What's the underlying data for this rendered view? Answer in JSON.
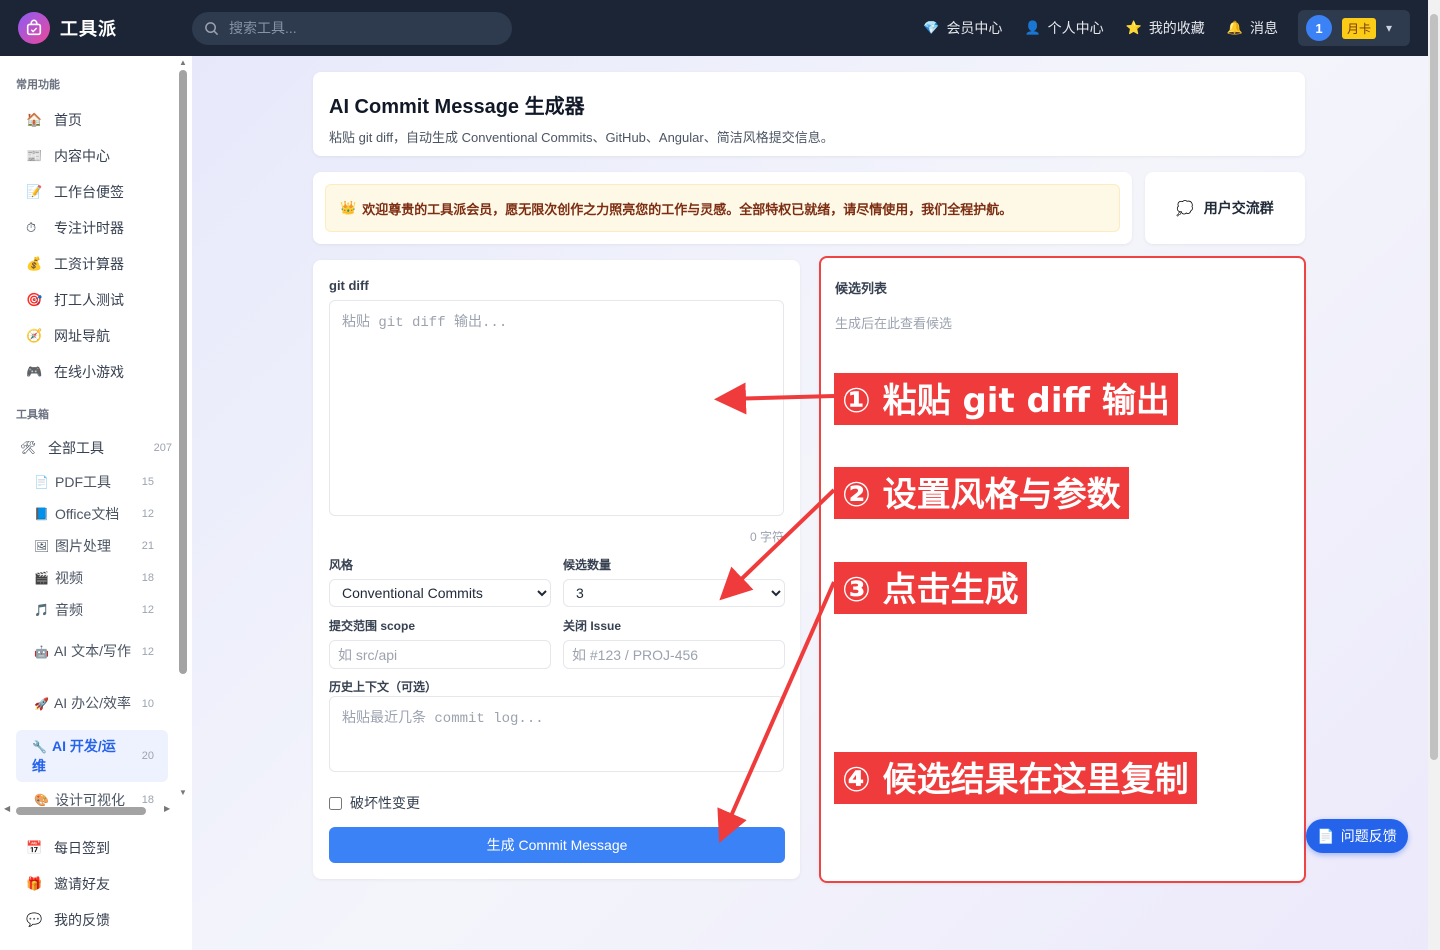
{
  "app": {
    "name": "工具派",
    "search_placeholder": "搜索工具..."
  },
  "topnav": {
    "links": [
      {
        "icon": "diamond-icon",
        "glyph": "💎",
        "label": "会员中心"
      },
      {
        "icon": "person-icon",
        "glyph": "👤",
        "label": "个人中心"
      },
      {
        "icon": "star-icon",
        "glyph": "⭐",
        "label": "我的收藏"
      },
      {
        "icon": "bell-icon",
        "glyph": "🔔",
        "label": "消息"
      }
    ],
    "user": {
      "avatar": "1",
      "plan": "月卡"
    }
  },
  "sidebar": {
    "section_common": "常用功能",
    "common": [
      {
        "glyph": "🏠",
        "label": "首页"
      },
      {
        "glyph": "📰",
        "label": "内容中心"
      },
      {
        "glyph": "📝",
        "label": "工作台便签"
      },
      {
        "glyph": "⏱",
        "label": "专注计时器"
      },
      {
        "glyph": "💰",
        "label": "工资计算器"
      },
      {
        "glyph": "🎯",
        "label": "打工人测试"
      },
      {
        "glyph": "🧭",
        "label": "网址导航"
      },
      {
        "glyph": "🎮",
        "label": "在线小游戏"
      }
    ],
    "section_tools": "工具箱",
    "all_tools": {
      "glyph": "🛠",
      "label": "全部工具",
      "count": "207"
    },
    "categories": [
      {
        "glyph": "📄",
        "label": "PDF工具",
        "count": "15"
      },
      {
        "glyph": "📘",
        "label": "Office文档",
        "count": "12"
      },
      {
        "glyph": "🖼",
        "label": "图片处理",
        "count": "21"
      },
      {
        "glyph": "🎬",
        "label": "视频",
        "count": "18"
      },
      {
        "glyph": "🎵",
        "label": "音频",
        "count": "12"
      },
      {
        "glyph": "🤖",
        "label": "AI 文本/写作",
        "count": "12"
      },
      {
        "glyph": "🚀",
        "label": "AI 办公/效率",
        "count": "10"
      },
      {
        "glyph": "🔧",
        "label": "AI 开发/运维",
        "count": "20",
        "active": true
      },
      {
        "glyph": "🎨",
        "label": "设计可视化",
        "count": "18"
      }
    ],
    "bottom": [
      {
        "glyph": "📅",
        "label": "每日签到"
      },
      {
        "glyph": "🎁",
        "label": "邀请好友"
      },
      {
        "glyph": "💬",
        "label": "我的反馈"
      }
    ]
  },
  "page": {
    "title": "AI Commit Message 生成器",
    "subtitle": "粘贴 git diff，自动生成 Conventional Commits、GitHub、Angular、简洁风格提交信息。",
    "notice": "欢迎尊贵的工具派会员，愿无限次创作之力照亮您的工作与灵感。全部特权已就绪，请尽情使用，我们全程护航。",
    "notice_glyph": "👑",
    "group_label": "用户交流群",
    "group_glyph": "💭"
  },
  "form": {
    "diff_label": "git diff",
    "diff_placeholder": "粘贴 git diff 输出...",
    "char_count": "0 字符",
    "style_label": "风格",
    "style_value": "Conventional Commits",
    "count_label": "候选数量",
    "count_value": "3",
    "scope_label": "提交范围 scope",
    "scope_placeholder": "如 src/api",
    "issue_label": "关闭 Issue",
    "issue_placeholder": "如 #123 / PROJ-456",
    "context_label": "历史上下文（可选）",
    "context_placeholder": "粘贴最近几条 commit log...",
    "breaking_label": "破坏性变更",
    "generate_button": "生成 Commit Message"
  },
  "candidates": {
    "title": "候选列表",
    "hint": "生成后在此查看候选"
  },
  "annotations": [
    "① 粘贴 git diff 输出",
    "② 设置风格与参数",
    "③ 点击生成",
    "④ 候选结果在这里复制"
  ],
  "feedback_button": "问题反馈",
  "colors": {
    "accent": "#3b82f6",
    "annotation": "#ef3b3b",
    "topbar": "#1c2536"
  }
}
